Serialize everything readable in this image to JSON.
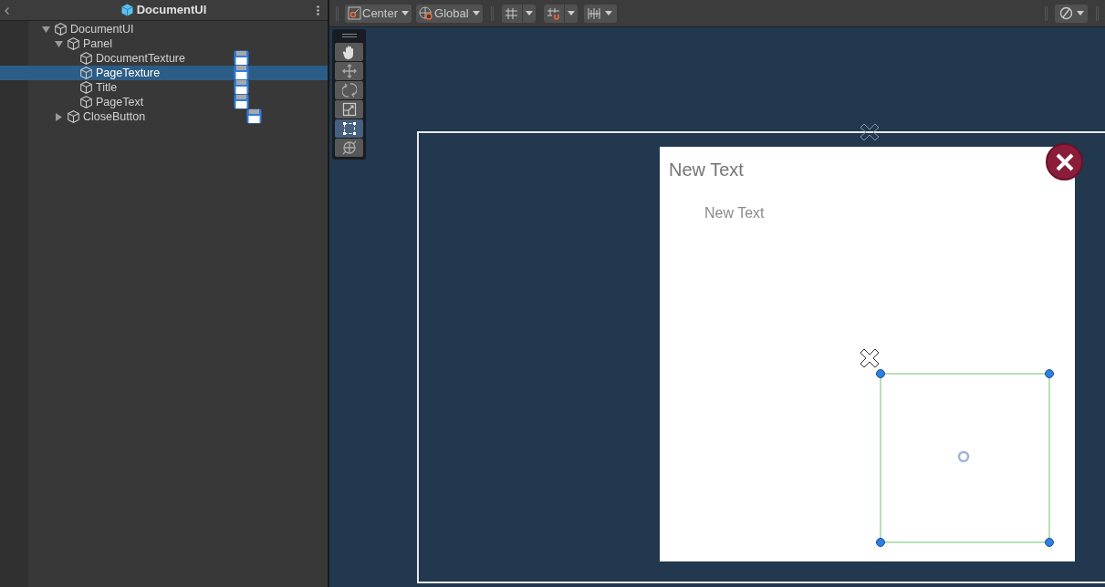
{
  "hierarchy": {
    "title": "DocumentUI",
    "items": [
      {
        "label": "DocumentUI",
        "expanded": true,
        "selected": false,
        "prefab_badge": false,
        "children": [
          {
            "label": "Panel",
            "expanded": true,
            "selected": false,
            "prefab_badge": false,
            "children": [
              {
                "label": "DocumentTexture",
                "selected": false,
                "prefab_badge": true
              },
              {
                "label": "PageTexture",
                "selected": true,
                "prefab_badge": true
              },
              {
                "label": "Title",
                "selected": false,
                "prefab_badge": true
              },
              {
                "label": "PageText",
                "selected": false,
                "prefab_badge": true
              }
            ]
          },
          {
            "label": "CloseButton",
            "expanded": false,
            "selected": false,
            "prefab_badge": true
          }
        ]
      }
    ]
  },
  "toolbar": {
    "pivot": "Center",
    "space": "Global"
  },
  "tools": [
    {
      "kind": "hand",
      "selected": false
    },
    {
      "kind": "move",
      "selected": false
    },
    {
      "kind": "rotate",
      "selected": false
    },
    {
      "kind": "scale",
      "selected": false
    },
    {
      "kind": "rect",
      "selected": true
    },
    {
      "kind": "transform",
      "selected": false
    }
  ],
  "scene": {
    "title_text": "New Text",
    "body_text": "New Text"
  }
}
